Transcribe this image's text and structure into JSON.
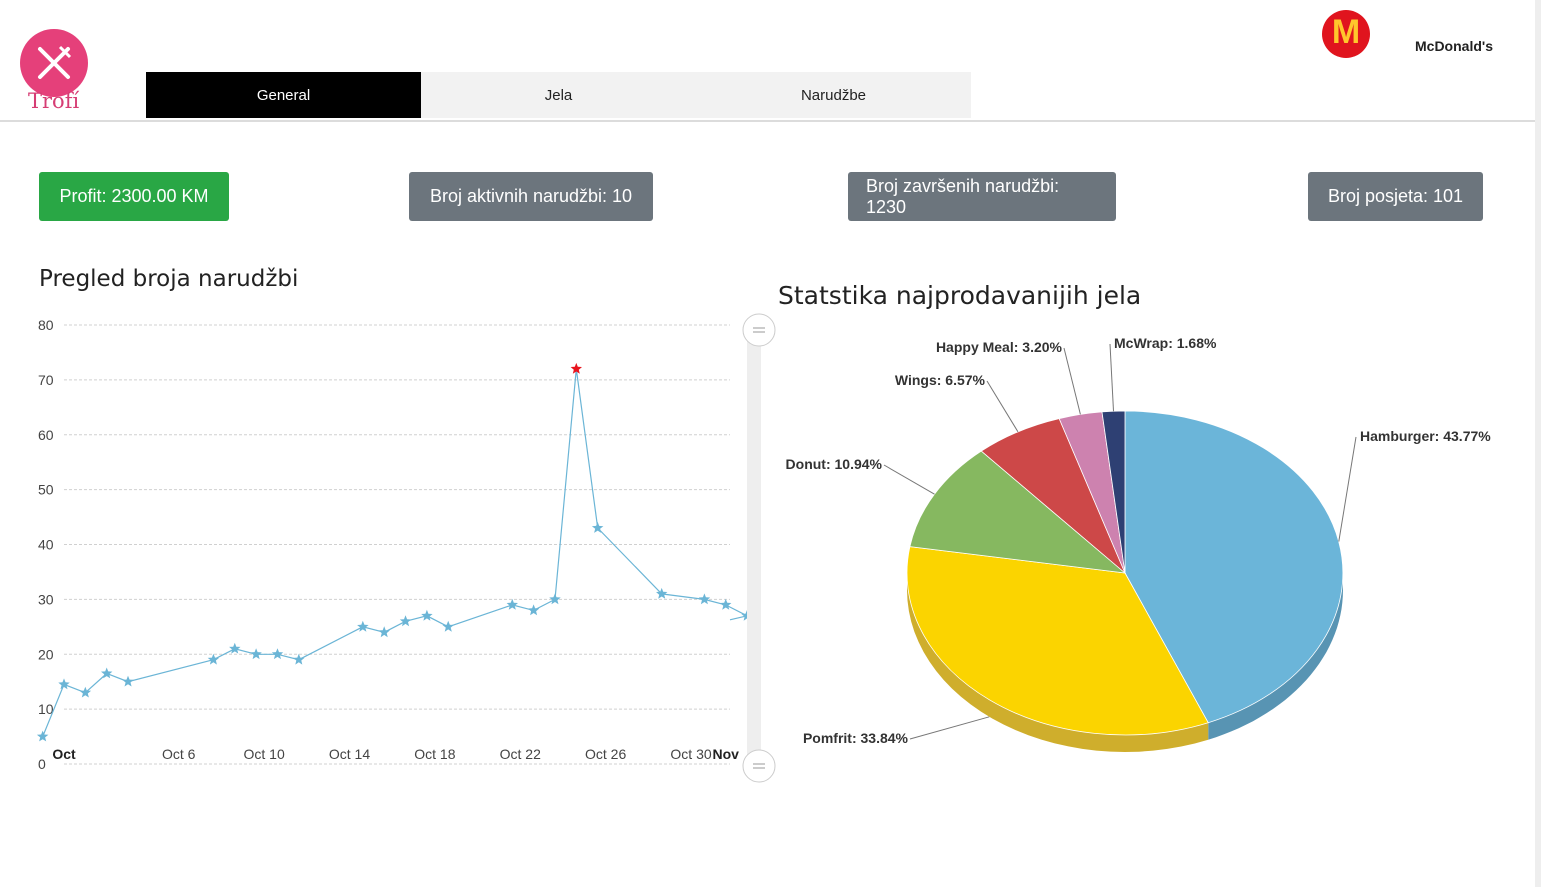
{
  "app": {
    "logo_text": "Trofí",
    "brand_name": "McDonald's",
    "brand_mark": "M"
  },
  "tabs": [
    {
      "label": "General",
      "active": true
    },
    {
      "label": "Jela",
      "active": false
    },
    {
      "label": "Narudžbe",
      "active": false
    }
  ],
  "stats": {
    "profit": "Profit: 2300.00 KM",
    "active_orders": "Broj aktivnih narudžbi: 10",
    "completed_orders": "Broj završenih narudžbi: 1230",
    "visits": "Broj posjeta: 101"
  },
  "colors": {
    "accent": "#e5407a",
    "active_tab": "#000000",
    "profit": "#29a745",
    "stat": "#6c757d"
  },
  "chart_data": [
    {
      "type": "line",
      "title": "Pregled broja narudžbi",
      "ylim": [
        0,
        80
      ],
      "yticks": [
        0,
        10,
        20,
        30,
        40,
        50,
        60,
        70,
        80
      ],
      "xlim": [
        "2021-10-01",
        "2021-11-01"
      ],
      "xticks": [
        {
          "label": "Oct",
          "x": "2021-10-01",
          "bold": true
        },
        {
          "label": "Oct 6",
          "x": "2021-10-06"
        },
        {
          "label": "Oct 10",
          "x": "2021-10-10"
        },
        {
          "label": "Oct 14",
          "x": "2021-10-14"
        },
        {
          "label": "Oct 18",
          "x": "2021-10-18"
        },
        {
          "label": "Oct 22",
          "x": "2021-10-22"
        },
        {
          "label": "Oct 26",
          "x": "2021-10-26"
        },
        {
          "label": "Oct 30",
          "x": "2021-10-30"
        },
        {
          "label": "Nov",
          "x": "2021-11-01",
          "bold": true
        }
      ],
      "marker": "star",
      "grid": true,
      "series": [
        {
          "color": "#6bb5d6",
          "highlight_color": "#e8141e",
          "points": [
            {
              "x": "2021-09-30",
              "y": 5
            },
            {
              "x": "2021-10-01",
              "y": 14.5
            },
            {
              "x": "2021-10-02",
              "y": 13
            },
            {
              "x": "2021-10-03",
              "y": 16.5
            },
            {
              "x": "2021-10-04",
              "y": 15
            },
            {
              "x": "2021-10-08",
              "y": 19
            },
            {
              "x": "2021-10-09",
              "y": 21
            },
            {
              "x": "2021-10-10",
              "y": 20
            },
            {
              "x": "2021-10-11",
              "y": 20
            },
            {
              "x": "2021-10-12",
              "y": 19
            },
            {
              "x": "2021-10-15",
              "y": 25
            },
            {
              "x": "2021-10-16",
              "y": 24
            },
            {
              "x": "2021-10-17",
              "y": 26
            },
            {
              "x": "2021-10-18",
              "y": 27
            },
            {
              "x": "2021-10-19",
              "y": 25
            },
            {
              "x": "2021-10-22",
              "y": 29
            },
            {
              "x": "2021-10-23",
              "y": 28
            },
            {
              "x": "2021-10-24",
              "y": 30
            },
            {
              "x": "2021-10-25",
              "y": 72,
              "highlight": true
            },
            {
              "x": "2021-10-26",
              "y": 43
            },
            {
              "x": "2021-10-29",
              "y": 31
            },
            {
              "x": "2021-10-31",
              "y": 30
            },
            {
              "x": "2021-11-01",
              "y": 29
            },
            {
              "x": "2021-11-02",
              "y": 27
            }
          ]
        }
      ]
    },
    {
      "type": "pie",
      "title": "Statstika najprodavanijih jela",
      "slices": [
        {
          "label": "Hamburger: 43.77%",
          "value": 43.77,
          "color": "#6bb5d9",
          "side_color": "#5894b3"
        },
        {
          "label": "Pomfrit: 33.84%",
          "value": 33.84,
          "color": "#fbd400",
          "side_color": "#cfae2c"
        },
        {
          "label": "Donut: 10.94%",
          "value": 10.94,
          "color": "#86b860",
          "side_color": "#6e9850"
        },
        {
          "label": "Wings: 6.57%",
          "value": 6.57,
          "color": "#cd4848",
          "side_color": "#a83b3b"
        },
        {
          "label": "Happy Meal: 3.20%",
          "value": 3.2,
          "color": "#cd82af",
          "side_color": "#a86b90"
        },
        {
          "label": "McWrap: 1.68%",
          "value": 1.68,
          "color": "#2e4073",
          "side_color": "#26355e"
        }
      ]
    }
  ]
}
